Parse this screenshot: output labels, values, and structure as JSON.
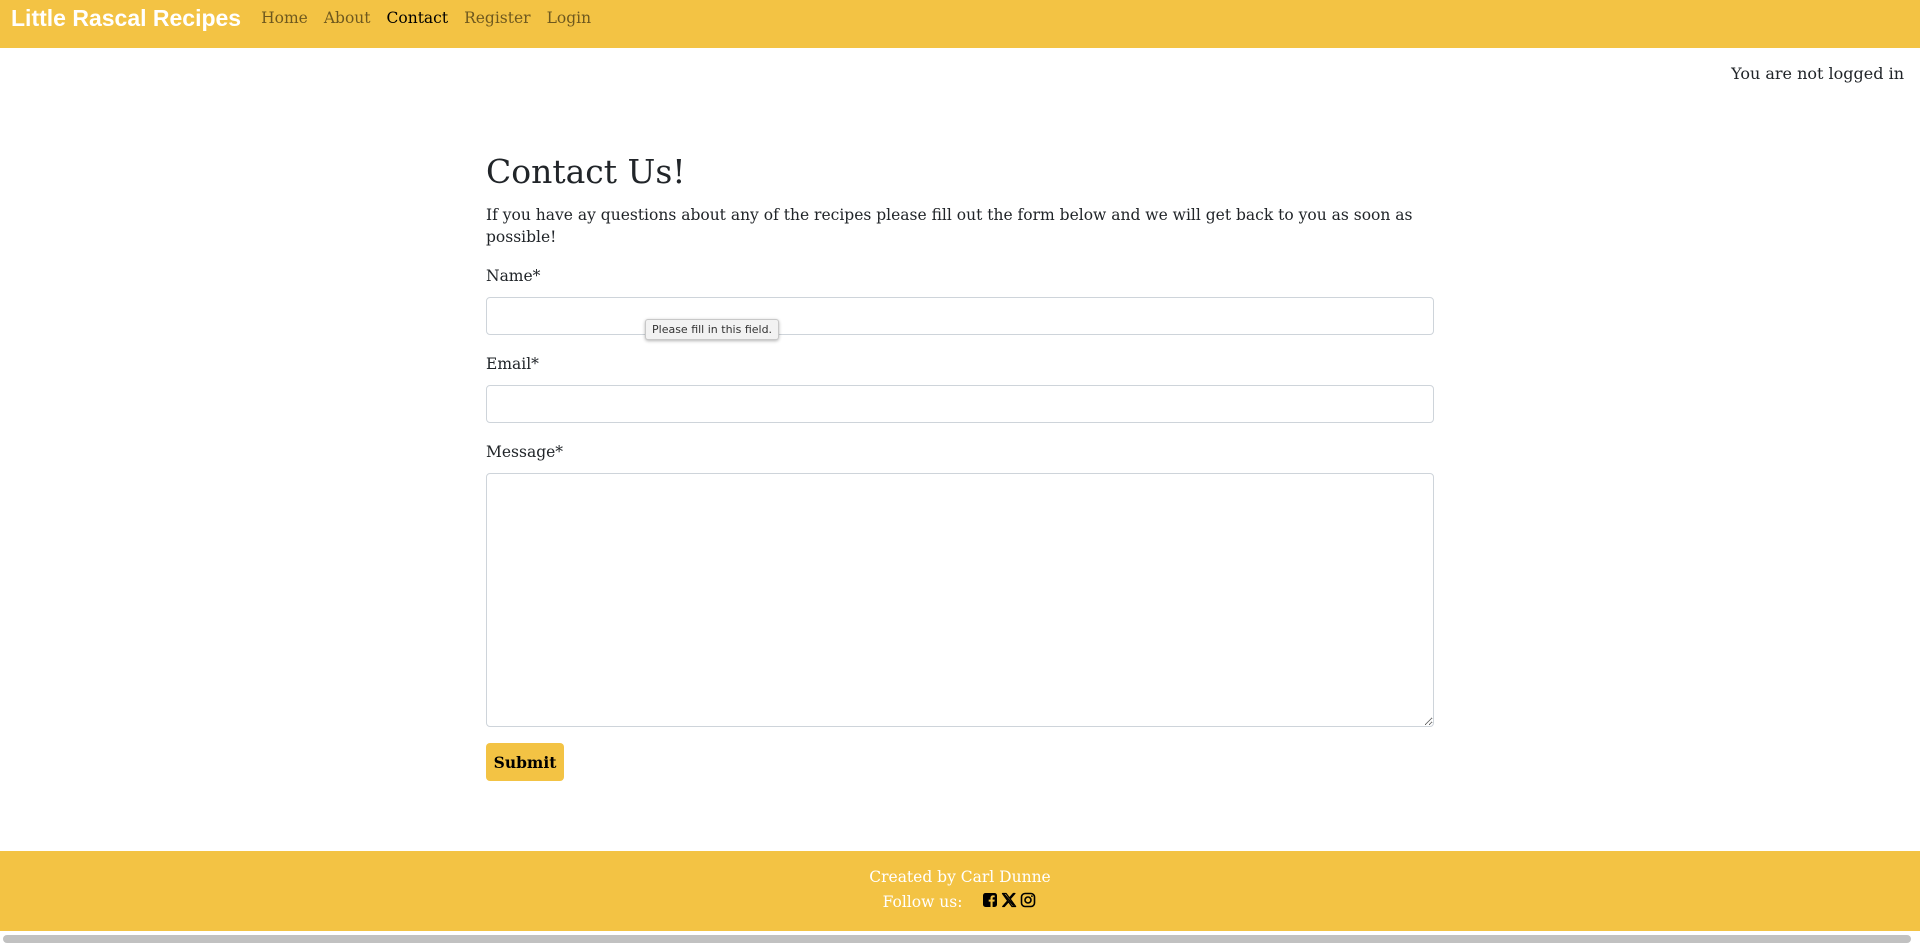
{
  "navbar": {
    "brand": "Little Rascal Recipes",
    "links": [
      {
        "label": "Home",
        "active": false
      },
      {
        "label": "About",
        "active": false
      },
      {
        "label": "Contact",
        "active": true
      },
      {
        "label": "Register",
        "active": false
      },
      {
        "label": "Login",
        "active": false
      }
    ],
    "bg_color": "#f3c344"
  },
  "login_status": "You are not logged in",
  "main": {
    "title": "Contact Us!",
    "intro": "If you have ay questions about any of the recipes please fill out the form below and we will get back to you as soon as possible!",
    "form": {
      "name_label": "Name*",
      "name_value": "",
      "email_label": "Email*",
      "email_value": "",
      "message_label": "Message*",
      "message_value": "",
      "submit_label": "Submit",
      "validation_tooltip": "Please fill in this field."
    }
  },
  "footer": {
    "created_by": "Created by Carl Dunne",
    "follow_label": "Follow us:",
    "social_icons": [
      "facebook-icon",
      "x-twitter-icon",
      "instagram-icon"
    ]
  }
}
